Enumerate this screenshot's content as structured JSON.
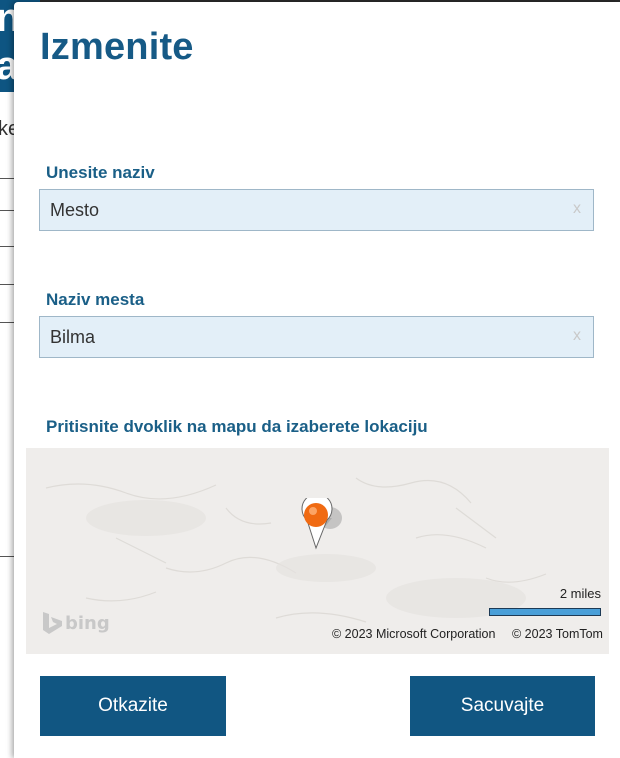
{
  "background": {
    "header_text": "n\na",
    "partial_text": "ke"
  },
  "dialog": {
    "title": "Izmenite",
    "name_label": "Unesite naziv",
    "name_value": "Mesto",
    "place_label": "Naziv mesta",
    "place_value": "Bilma",
    "clear_glyph": "x",
    "map_instruction": "Pritisnite dvoklik na mapu da izaberete lokaciju",
    "map": {
      "scale_label": "2 miles",
      "logo_text": "bing",
      "copyright_microsoft": "© 2023 Microsoft Corporation",
      "copyright_tomtom": "© 2023 TomTom"
    },
    "cancel_label": "Otkazite",
    "save_label": "Sacuvajte"
  },
  "colors": {
    "accent": "#115682",
    "field_bg": "#e3eff8",
    "pin": "#f06a12"
  }
}
